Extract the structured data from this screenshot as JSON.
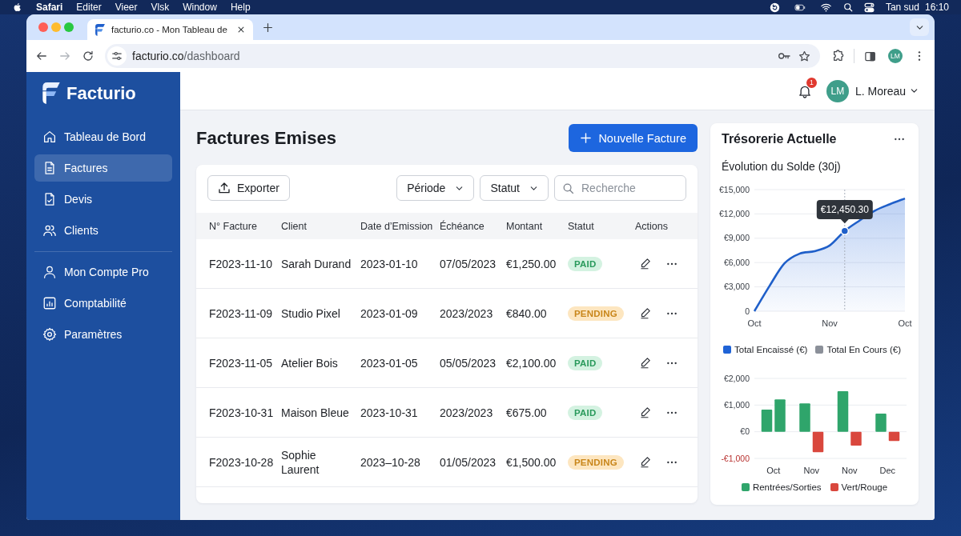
{
  "menu_bar": {
    "app_name": "Safari",
    "menus": [
      "Editer",
      "Vieer",
      "Vlsk",
      "Window",
      "Help"
    ],
    "status_text": "Tan sud",
    "clock": "16:10"
  },
  "browser": {
    "tab": {
      "title": "facturio.co - Mon Tableau de"
    },
    "address": {
      "host": "facturio.co",
      "path": "/dashboard"
    },
    "profile_initials": "LM"
  },
  "sidebar": {
    "brand": "Facturio",
    "groups": [
      {
        "items": [
          {
            "label": "Tableau de Bord",
            "selected": false
          },
          {
            "label": "Factures",
            "selected": true
          },
          {
            "label": "Devis",
            "selected": false
          },
          {
            "label": "Clients",
            "selected": false
          }
        ]
      },
      {
        "items": [
          {
            "label": "Mon Compte Pro",
            "selected": false
          },
          {
            "label": "Comptabilité",
            "selected": false
          },
          {
            "label": "Paramètres",
            "selected": false
          }
        ]
      }
    ]
  },
  "header": {
    "notification_count": "1",
    "user": {
      "initials": "LM",
      "name": "L. Moreau"
    }
  },
  "invoices": {
    "title": "Factures Emises",
    "new_button": "Nouvelle Facture",
    "export_button": "Exporter",
    "filters": [
      "Période",
      "Statut"
    ],
    "search": {
      "placeholder": "Recherche"
    },
    "table": {
      "columns": [
        "N° Facture",
        "Client",
        "Date d’Emission",
        "Échéance",
        "Montant",
        "Statut",
        "Actions"
      ],
      "rows": [
        {
          "number": "F2023-11-10",
          "client": "Sarah Durand",
          "issued": "2023-01-10",
          "due": "07/05/2023",
          "amount": "€1,250.00",
          "status": {
            "label": "PAID",
            "kind": "paid"
          }
        },
        {
          "number": "F2023-11-09",
          "client": "Studio Pixel",
          "issued": "2023-01-09",
          "due": "2023/2023",
          "amount": "€840.00",
          "status": {
            "label": "PENDING",
            "kind": "pending"
          }
        },
        {
          "number": "F2023-11-05",
          "client": "Atelier Bois",
          "issued": "2023-01-05",
          "due": "05/05/2023",
          "amount": "€2,100.00",
          "status": {
            "label": "PAID",
            "kind": "paid"
          }
        },
        {
          "number": "F2023-10-31",
          "client": "Maison Bleue",
          "issued": "2023-10-31",
          "due": "2023/2023",
          "amount": "€675.00",
          "status": {
            "label": "PAID",
            "kind": "paid"
          }
        },
        {
          "number": "F2023-10-28",
          "client": "Sophie Laurent",
          "issued": "2023–10-28",
          "due": "01/05/2023",
          "amount": "€1,500.00",
          "status": {
            "label": "PENDING",
            "kind": "pending"
          }
        }
      ]
    }
  },
  "treasury": {
    "title": "Trésorerie Actuelle",
    "balance": {
      "chart_data": {
        "type": "area",
        "title": "Évolution du Solde (30j)",
        "categories": [
          "Oct",
          null,
          null,
          null,
          null,
          "Nov",
          null,
          null,
          null,
          null,
          "Oct"
        ],
        "values": [
          0,
          3100,
          5900,
          7100,
          7400,
          8100,
          9900,
          11200,
          12400,
          13200,
          13900
        ],
        "ylim": [
          0,
          15000
        ],
        "yticks": [
          {
            "value": 0,
            "label": "0"
          },
          {
            "value": 3000,
            "label": "€3,000"
          },
          {
            "value": 6000,
            "label": "€6,000"
          },
          {
            "value": 9000,
            "label": "€9,000"
          },
          {
            "value": 12000,
            "label": "€12,000"
          },
          {
            "value": 15000,
            "label": "€15,000"
          }
        ],
        "grid": true,
        "annotations": [
          {
            "y": 9900,
            "text": "€12,450.30"
          }
        ]
      }
    },
    "legend": [
      {
        "label": "Total Encaissé (€)",
        "color": "#1f63d6"
      },
      {
        "label": "Total En Cours (€)",
        "color": "#8b9099"
      }
    ],
    "cashflow": {
      "chart_data": {
        "type": "bar",
        "categories": [
          "Oct",
          "Nov",
          "Nov",
          "Dec"
        ],
        "series": [
          {
            "name": "Rentrées/Sorties",
            "color": "#2fa56b",
            "values": [
              830,
              1060,
              1520,
              680
            ]
          },
          {
            "name": "Vert/Rouge",
            "color": "#d9473d",
            "values": [
              null,
              -770,
              -520,
              -350
            ]
          },
          {
            "color": "#2fa56b",
            "values": [
              1210,
              null,
              null,
              null
            ]
          }
        ],
        "ylim": [
          -1000,
          2000
        ],
        "yticks": [
          {
            "value": -1000,
            "label": "-€1,000"
          },
          {
            "value": 0,
            "label": "€0"
          },
          {
            "value": 1000,
            "label": "€1,000"
          },
          {
            "value": 2000,
            "label": "€2,000"
          }
        ],
        "grid": true
      }
    }
  }
}
